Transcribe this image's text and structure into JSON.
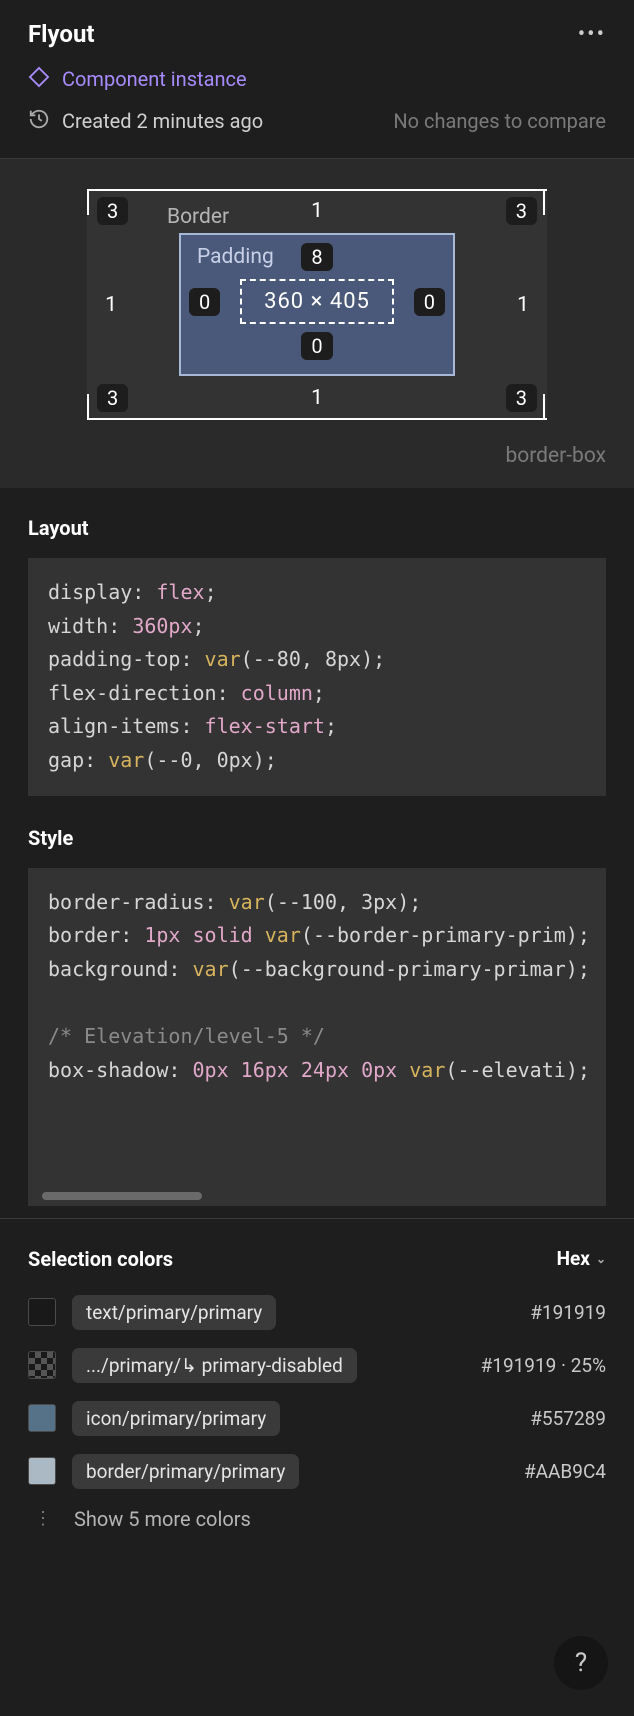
{
  "header": {
    "title": "Flyout",
    "instance_label": "Component instance",
    "created_label": "Created 2 minutes ago",
    "nochanges_label": "No changes to compare"
  },
  "boxmodel": {
    "border_label": "Border",
    "padding_label": "Padding",
    "border": {
      "top": "1",
      "right": "1",
      "bottom": "1",
      "left": "1"
    },
    "corner": {
      "tl": "3",
      "tr": "3",
      "bl": "3",
      "br": "3"
    },
    "padding": {
      "top": "8",
      "right": "0",
      "bottom": "0",
      "left": "0"
    },
    "content": "360 × 405",
    "box_sizing": "border-box"
  },
  "layout": {
    "title": "Layout",
    "lines": [
      {
        "prop": "display",
        "val": "flex"
      },
      {
        "prop": "width",
        "val": "360px"
      },
      {
        "prop": "padding-top",
        "func": "var",
        "args": "--80, 8px"
      },
      {
        "prop": "flex-direction",
        "val": "column"
      },
      {
        "prop": "align-items",
        "val": "flex-start"
      },
      {
        "prop": "gap",
        "func": "var",
        "args": "--0, 0px"
      }
    ]
  },
  "style": {
    "title": "Style",
    "lines": [
      {
        "prop": "border-radius",
        "func": "var",
        "args": "--100, 3px"
      },
      {
        "prop": "border",
        "prefix": "1px solid ",
        "func": "var",
        "args": "--border-primary-prim"
      },
      {
        "prop": "background",
        "func": "var",
        "args": "--background-primary-primar"
      },
      {
        "blank": true
      },
      {
        "comment": "/* Elevation/level-5 */"
      },
      {
        "prop": "box-shadow",
        "prefix": "0px 16px 24px 0px ",
        "func": "var",
        "args": "--elevati"
      }
    ]
  },
  "colors": {
    "title": "Selection colors",
    "format_label": "Hex",
    "items": [
      {
        "swatch": "#191919",
        "name": "text/primary/primary",
        "hex": "#191919",
        "alpha": ""
      },
      {
        "swatch": "checker",
        "name": ".../primary/↳ primary-disabled",
        "hex": "#191919",
        "alpha": " · 25%"
      },
      {
        "swatch": "#557289",
        "name": "icon/primary/primary",
        "hex": "#557289",
        "alpha": ""
      },
      {
        "swatch": "#AAB9C4",
        "name": "border/primary/primary",
        "hex": "#AAB9C4",
        "alpha": ""
      }
    ],
    "show_more": "Show 5 more colors"
  },
  "help": "?"
}
